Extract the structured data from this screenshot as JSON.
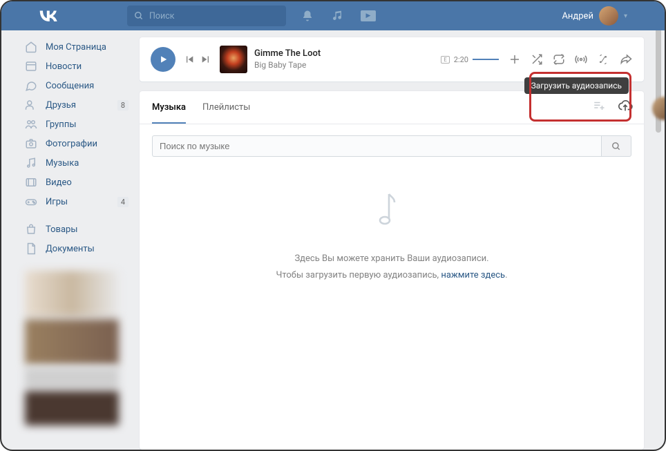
{
  "header": {
    "search_placeholder": "Поиск",
    "username": "Андрей"
  },
  "sidebar": {
    "items": [
      {
        "label": "Моя Страница"
      },
      {
        "label": "Новости"
      },
      {
        "label": "Сообщения"
      },
      {
        "label": "Друзья",
        "badge": "8"
      },
      {
        "label": "Группы"
      },
      {
        "label": "Фотографии"
      },
      {
        "label": "Музыка"
      },
      {
        "label": "Видео"
      },
      {
        "label": "Игры",
        "badge": "4"
      },
      {
        "label": "Товары"
      },
      {
        "label": "Документы"
      }
    ]
  },
  "player": {
    "track_title": "Gimme The Loot",
    "track_artist": "Big Baby Tape",
    "time": "2:20",
    "explicit_marker": "E"
  },
  "tabs": {
    "music": "Музыка",
    "playlists": "Плейлисты"
  },
  "tooltip": "Загрузить аудиозапись",
  "search": {
    "placeholder": "Поиск по музыке"
  },
  "empty": {
    "line1": "Здесь Вы можете хранить Ваши аудиозаписи.",
    "line2_a": "Чтобы загрузить первую аудиозапись, ",
    "line2_link": "нажмите здесь",
    "line2_b": "."
  }
}
